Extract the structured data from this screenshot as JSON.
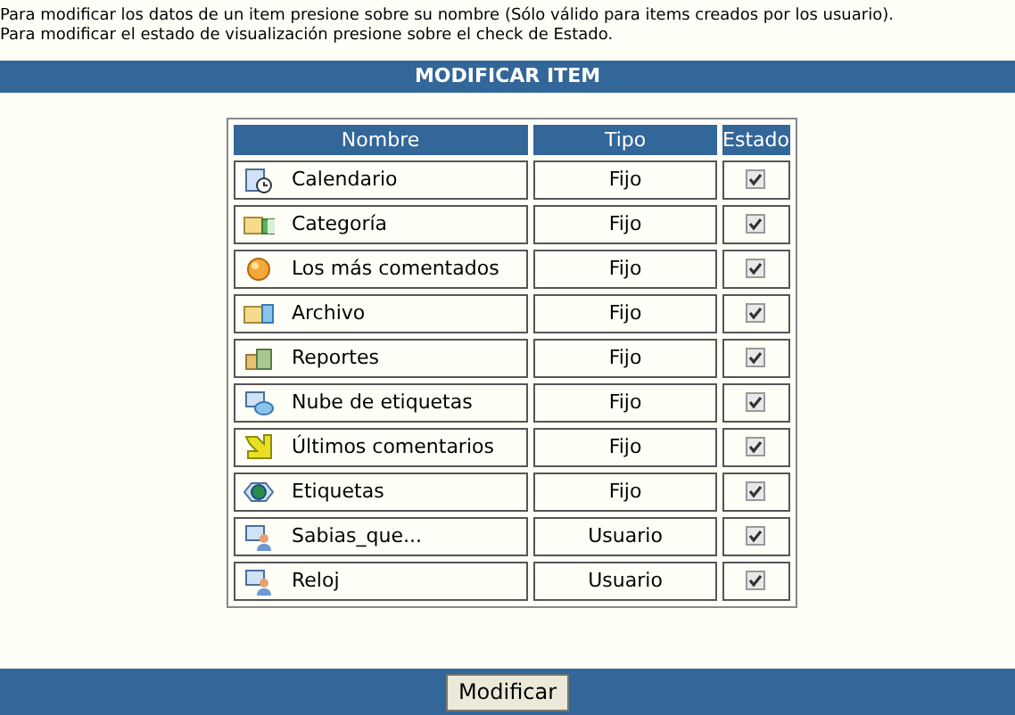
{
  "instructions": [
    "Para modificar los datos de un item presione sobre su nombre (Sólo válido para items creados por los usuario).",
    "Para modificar el estado de visualización presione sobre el check de Estado."
  ],
  "title": "MODIFICAR ITEM",
  "table": {
    "columns": [
      "Nombre",
      "Tipo",
      "Estado"
    ],
    "rows": [
      {
        "nombre": "Calendario",
        "tipo": "Fijo",
        "checked": true
      },
      {
        "nombre": "Categoría",
        "tipo": "Fijo",
        "checked": true
      },
      {
        "nombre": "Los más comentados",
        "tipo": "Fijo",
        "checked": true
      },
      {
        "nombre": "Archivo",
        "tipo": "Fijo",
        "checked": true
      },
      {
        "nombre": "Reportes",
        "tipo": "Fijo",
        "checked": true
      },
      {
        "nombre": "Nube de etiquetas",
        "tipo": "Fijo",
        "checked": true
      },
      {
        "nombre": "Últimos comentarios",
        "tipo": "Fijo",
        "checked": true
      },
      {
        "nombre": "Etiquetas",
        "tipo": "Fijo",
        "checked": true
      },
      {
        "nombre": "Sabias_que...",
        "tipo": "Usuario",
        "checked": true
      },
      {
        "nombre": "Reloj",
        "tipo": "Usuario",
        "checked": true
      }
    ]
  },
  "button": "Modificar"
}
